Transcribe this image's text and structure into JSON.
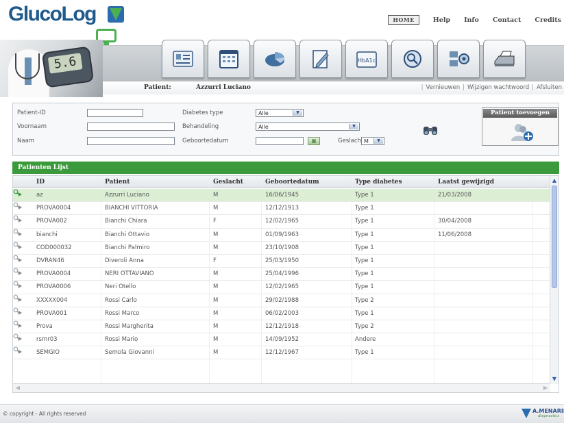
{
  "app": {
    "logo_text": "GlucoLog",
    "nav": [
      "HOME",
      "Help",
      "Info",
      "Contact",
      "Credits"
    ]
  },
  "banner": {
    "meter_reading": "5.6",
    "tabs": [
      {
        "icon": "patient-card-icon"
      },
      {
        "icon": "calendar-icon"
      },
      {
        "icon": "pie-chart-icon"
      },
      {
        "icon": "document-edit-icon"
      },
      {
        "icon": "hba1c-icon",
        "label": "HbA1c"
      },
      {
        "icon": "search-settings-icon"
      },
      {
        "icon": "network-settings-icon"
      },
      {
        "icon": "printer-icon"
      }
    ]
  },
  "patient_bar": {
    "label": "Patient:",
    "name": "Azzurri Luciano",
    "links": [
      "Vernieuwen",
      "Wijzigen wachtwoord",
      "Afsluiten"
    ]
  },
  "search": {
    "labels": {
      "patient_id": "Patient-ID",
      "voornaam": "Voornaam",
      "naam": "Naam",
      "diabetes_type": "Diabetes type",
      "behandeling": "Behandeling",
      "geboortedatum": "Geboortedatum",
      "geslacht": "Geslacht"
    },
    "values": {
      "patient_id": "",
      "voornaam": "",
      "naam": "",
      "diabetes_type": "Alle",
      "behandeling": "Alle",
      "geboortedatum": "",
      "geslacht": "M"
    },
    "add_patient_label": "Patient toevoegen"
  },
  "list": {
    "title": "Patienten Lijst",
    "columns": [
      "ID",
      "Patient",
      "Geslacht",
      "Geboortedatum",
      "Type diabetes",
      "Laatst gewijzigd"
    ],
    "rows": [
      {
        "id": "az",
        "patient": "Azzurri Luciano",
        "geslacht": "M",
        "geboortedatum": "16/06/1945",
        "type": "Type 1",
        "gewijzigd": "21/03/2008",
        "selected": true
      },
      {
        "id": "PROVA0004",
        "patient": "BIANCHI VITTORIA",
        "geslacht": "M",
        "geboortedatum": "12/12/1913",
        "type": "Type 1",
        "gewijzigd": ""
      },
      {
        "id": "PROVA002",
        "patient": "Bianchi Chiara",
        "geslacht": "F",
        "geboortedatum": "12/02/1965",
        "type": "Type 1",
        "gewijzigd": "30/04/2008"
      },
      {
        "id": "bianchi",
        "patient": "Bianchi Ottavio",
        "geslacht": "M",
        "geboortedatum": "01/09/1963",
        "type": "Type 1",
        "gewijzigd": "11/06/2008"
      },
      {
        "id": "COD000032",
        "patient": "Bianchi Palmiro",
        "geslacht": "M",
        "geboortedatum": "23/10/1908",
        "type": "Type 1",
        "gewijzigd": ""
      },
      {
        "id": "DVRAN46",
        "patient": "Diveroli Anna",
        "geslacht": "F",
        "geboortedatum": "25/03/1950",
        "type": "Type 1",
        "gewijzigd": ""
      },
      {
        "id": "PROVA0004",
        "patient": "NERI OTTAVIANO",
        "geslacht": "M",
        "geboortedatum": "25/04/1996",
        "type": "Type 1",
        "gewijzigd": ""
      },
      {
        "id": "PROVA0006",
        "patient": "Neri Otello",
        "geslacht": "M",
        "geboortedatum": "12/02/1965",
        "type": "Type 1",
        "gewijzigd": ""
      },
      {
        "id": "XXXXX004",
        "patient": "Rossi Carlo",
        "geslacht": "M",
        "geboortedatum": "29/02/1988",
        "type": "Type 2",
        "gewijzigd": ""
      },
      {
        "id": "PROVA001",
        "patient": "Rossi Marco",
        "geslacht": "M",
        "geboortedatum": "06/02/2003",
        "type": "Type 1",
        "gewijzigd": ""
      },
      {
        "id": "Prova",
        "patient": "Rossi Margherita",
        "geslacht": "M",
        "geboortedatum": "12/12/1918",
        "type": "Type 2",
        "gewijzigd": ""
      },
      {
        "id": "rsmr03",
        "patient": "Rossi Mario",
        "geslacht": "M",
        "geboortedatum": "14/09/1952",
        "type": "Andere",
        "gewijzigd": ""
      },
      {
        "id": "SEMGIO",
        "patient": "Semola Giovanni",
        "geslacht": "M",
        "geboortedatum": "12/12/1967",
        "type": "Type 1",
        "gewijzigd": ""
      }
    ]
  },
  "footer": {
    "copyright": "© copyright - All rights reserved",
    "brand": "A.MENARINI",
    "brand_sub": "diagnostics"
  },
  "colors": {
    "brand_blue": "#1f5a8c",
    "list_green": "#3b9a3b",
    "selected_row": "#dcefd4"
  }
}
